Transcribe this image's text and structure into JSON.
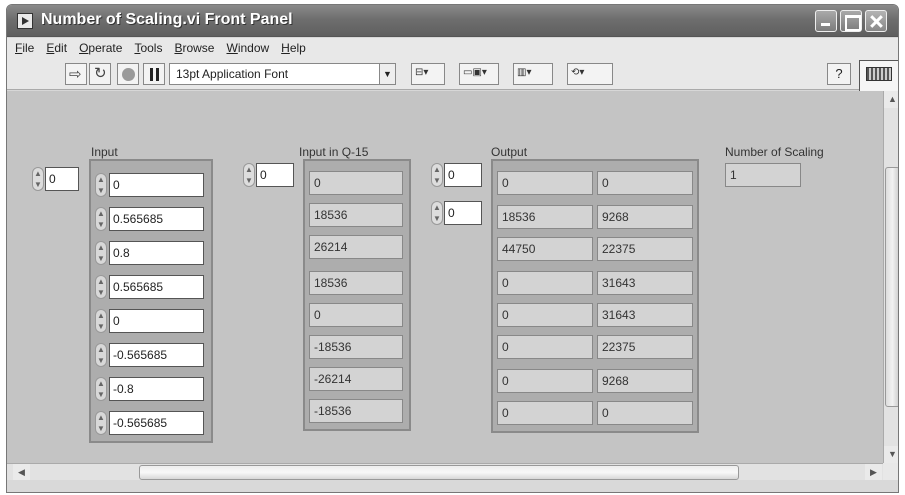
{
  "window": {
    "title": "Number of Scaling.vi Front Panel"
  },
  "menu": [
    "File",
    "Edit",
    "Operate",
    "Tools",
    "Browse",
    "Window",
    "Help"
  ],
  "toolbar": {
    "font": "13pt Application Font",
    "help": "?",
    "icon_number": "2"
  },
  "input": {
    "label": "Input",
    "index": "0",
    "values": [
      "0",
      "0.565685",
      "0.8",
      "0.565685",
      "0",
      "-0.565685",
      "-0.8",
      "-0.565685"
    ]
  },
  "input_q15": {
    "label": "Input in Q-15",
    "index": "0",
    "values": [
      "0",
      "18536",
      "26214",
      "18536",
      "0",
      "-18536",
      "-26214",
      "-18536"
    ]
  },
  "output": {
    "label": "Output",
    "row_index": "0",
    "col_index": "0",
    "col1": [
      "0",
      "18536",
      "44750",
      "0",
      "0",
      "0",
      "0",
      "0"
    ],
    "col2": [
      "0",
      "9268",
      "22375",
      "31643",
      "31643",
      "22375",
      "9268",
      "0"
    ]
  },
  "scaling": {
    "label": "Number of Scaling",
    "value": "1"
  },
  "icons": {
    "run": "run-arrow-icon",
    "run_continuously": "run-continuously-icon",
    "abort": "abort-icon",
    "pause": "pause-icon"
  }
}
